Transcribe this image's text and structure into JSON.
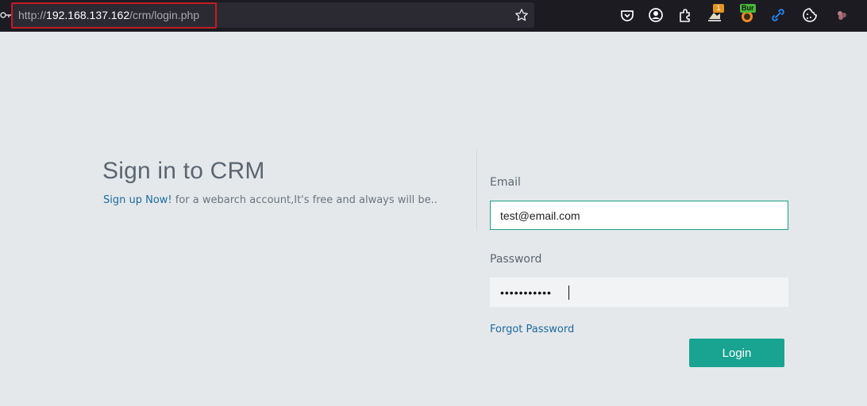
{
  "browser": {
    "url_scheme": "http://",
    "url_host": "192.168.137.162",
    "url_path": "/crm/login.php",
    "extension_badge_count": "1",
    "extension_badge_label": "Bur",
    "icons": [
      "key-icon",
      "bookmark-star-icon",
      "pocket-icon",
      "account-icon",
      "extensions-icon",
      "download-extension-icon",
      "burp-extension-icon",
      "link-extension-icon",
      "cookie-icon",
      "dots-extension-icon"
    ]
  },
  "login": {
    "heading": "Sign in to CRM",
    "signup_link": "Sign up Now!",
    "signup_text": " for a webarch account,It's free and always will be..",
    "email_label": "Email",
    "email_value": "test@email.com",
    "password_label": "Password",
    "password_value": "•••••••••••",
    "forgot_link": "Forgot Password",
    "login_button": "Login"
  },
  "colors": {
    "accent": "#19a391",
    "link": "#1b6aa0",
    "url_highlight": "#c21c24"
  }
}
